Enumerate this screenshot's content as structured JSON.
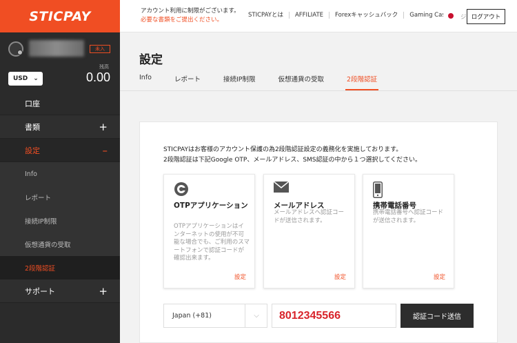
{
  "brand": {
    "logo": "STICPAY",
    "accent": "#f04e23"
  },
  "header": {
    "notice_line1": "アカウント利用に制限がございます。",
    "notice_line2": "必要な書類をご提出ください。",
    "nav": [
      "STICPAYとは",
      "AFFILIATE",
      "Forexキャッシュバック",
      "Gaming Cashback"
    ],
    "logout_label": "ログアウト",
    "logout_ghost": "ジ"
  },
  "user": {
    "badge": "未入"
  },
  "wallet": {
    "currency": "USD",
    "balance_label": "残高",
    "balance": "0.00"
  },
  "sidebar": {
    "items": [
      {
        "label": "口座"
      },
      {
        "label": "書類",
        "toggle": "+"
      },
      {
        "label": "設定",
        "toggle": "–"
      },
      {
        "label": "サポート",
        "toggle": "+"
      }
    ],
    "submenu": [
      "Info",
      "レポート",
      "接続IP制限",
      "仮想通貨の受取",
      "2段階認証"
    ]
  },
  "page": {
    "title": "設定",
    "tabs": [
      "Info",
      "レポート",
      "接続IP制限",
      "仮想通貨の受取",
      "2段階認証"
    ],
    "active_tab": "2段階認証"
  },
  "twofa": {
    "desc_line1": "STICPAYはお客様のアカウント保護の為2段階認証設定の義務化を実施しております。",
    "desc_line2": "2段階認証は下記Google OTP、メールアドレス、SMS認証の中から１つ選択してください。",
    "methods": [
      {
        "icon": "google-otp-icon",
        "title": "OTPアプリケーション",
        "desc": "OTPアプリケーションはインターネットの使用が不可能な場合でも、ご利用のスマートフォンで認証コードが確認出来ます。",
        "link": "設定"
      },
      {
        "icon": "mail-icon",
        "title": "メールアドレス",
        "desc": "メールアドレスへ認証コードが送信されます。",
        "link": "設定"
      },
      {
        "icon": "mobile-phone-icon",
        "title": "携帯電話番号",
        "desc": "携帯電話番号へ認証コードが送信されます。",
        "link": "設定"
      }
    ],
    "country": "Japan (+81)",
    "phone": "8012345566",
    "send_label": "認証コード送信"
  }
}
